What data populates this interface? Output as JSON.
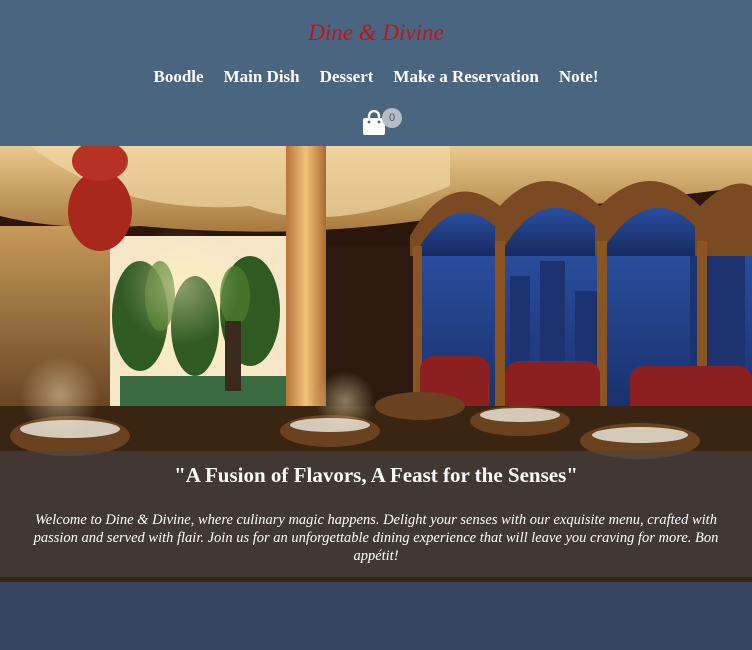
{
  "brand": {
    "title": "Dine & Divine"
  },
  "nav": {
    "items": [
      {
        "label": "Boodle"
      },
      {
        "label": "Main Dish"
      },
      {
        "label": "Dessert"
      },
      {
        "label": "Make a Reservation"
      },
      {
        "label": "Note!"
      }
    ]
  },
  "cart": {
    "icon": "shopping-bag-icon",
    "count": "0"
  },
  "hero": {
    "image": "restaurant-interior-photo",
    "tagline": "\"A Fusion of Flavors, A Feast for the Senses\"",
    "welcome": "Welcome to Dine & Divine, where culinary magic happens. Delight your senses with our exquisite menu, crafted with passion and served with flair. Join us for an unforgettable dining experience that will leave you craving for more. Bon appétit!"
  },
  "colors": {
    "header_bg": "#4a6580",
    "page_bg": "#34455f",
    "brand_red": "#c0121b",
    "nav_text": "#ffffff"
  }
}
